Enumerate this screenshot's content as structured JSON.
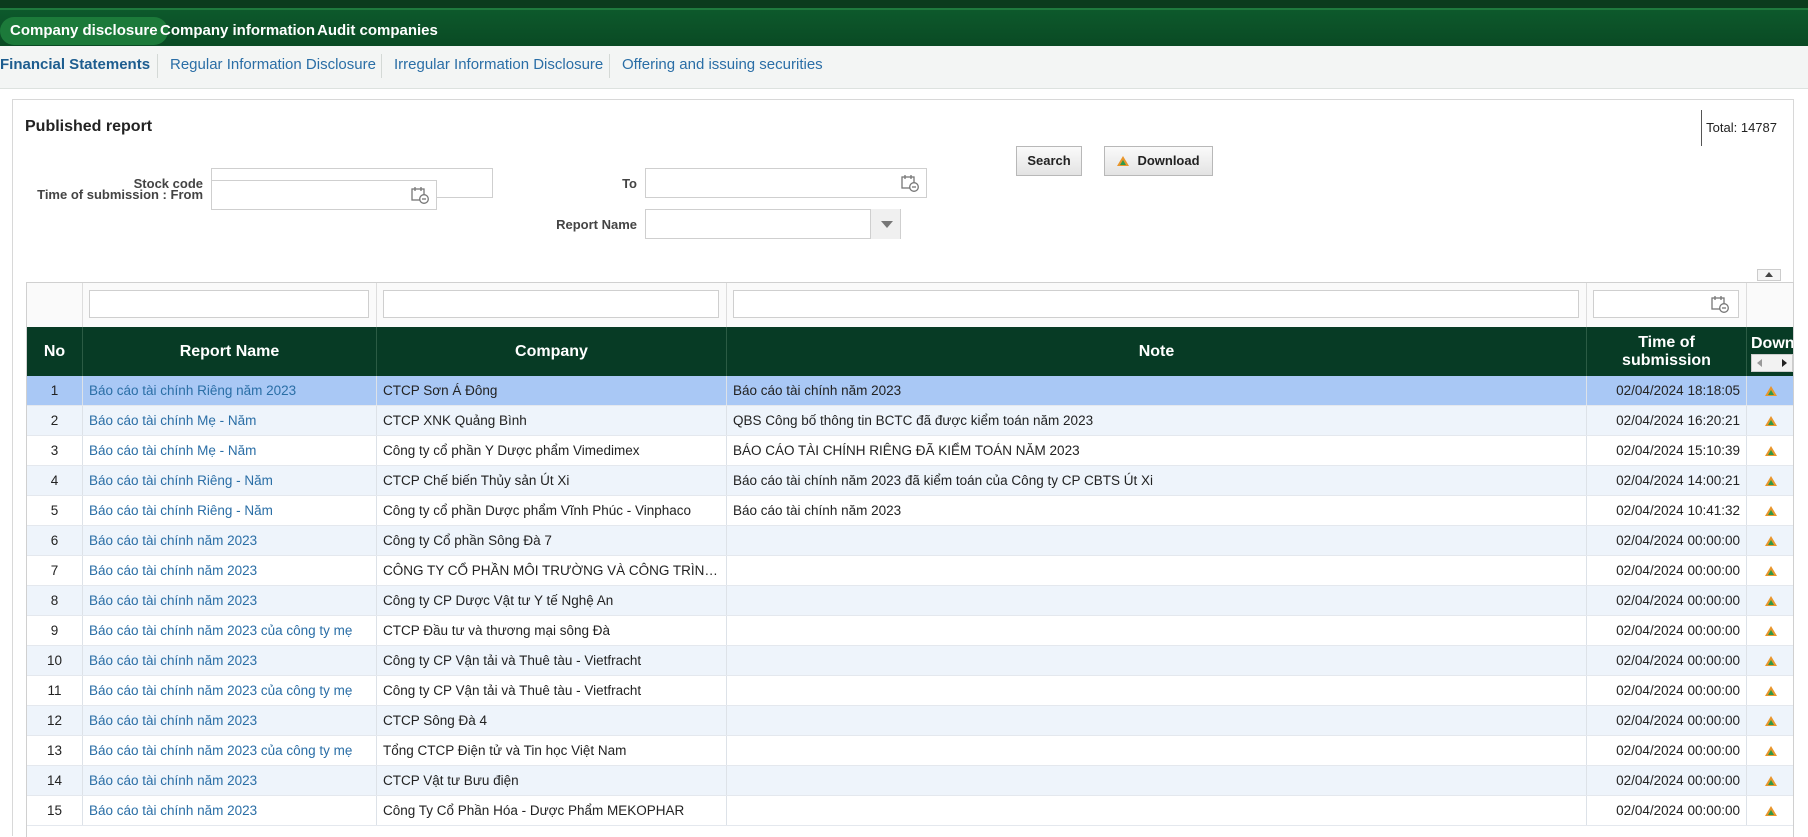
{
  "topnav": {
    "items": [
      "Company disclosure",
      "Company information",
      "Audit companies"
    ]
  },
  "subnav": {
    "items": [
      "Financial Statements",
      "Regular Information Disclosure",
      "Irregular Information Disclosure",
      "Offering and issuing securities"
    ]
  },
  "panel": {
    "title": "Published report",
    "total": "Total: 14787"
  },
  "form": {
    "stock_code_label": "Stock code",
    "to_label": "To",
    "from_label": "Time of submission : From",
    "report_name_label": "Report Name",
    "search_label": "Search",
    "download_label": "Download"
  },
  "table": {
    "columns": [
      "No",
      "Report Name",
      "Company",
      "Note",
      "Time of submission",
      "Down"
    ],
    "rows": [
      {
        "no": "1",
        "report": "Báo cáo tài chính Riêng năm 2023",
        "company": "CTCP Sơn Á Đông",
        "note": "Báo cáo tài chính năm 2023",
        "time": "02/04/2024 18:18:05"
      },
      {
        "no": "2",
        "report": "Báo cáo tài chính Mẹ - Năm",
        "company": "CTCP XNK Quảng Bình",
        "note": "QBS Công bố thông tin BCTC đã được kiểm toán năm 2023",
        "time": "02/04/2024 16:20:21"
      },
      {
        "no": "3",
        "report": "Báo cáo tài chính Mẹ - Năm",
        "company": "Công ty cổ phần Y Dược phẩm Vimedimex",
        "note": "BÁO CÁO TÀI CHÍNH RIÊNG ĐÃ KIỂM TOÁN NĂM 2023",
        "time": "02/04/2024 15:10:39"
      },
      {
        "no": "4",
        "report": "Báo cáo tài chính Riêng - Năm",
        "company": "CTCP Chế biến Thủy sản Út Xi",
        "note": "Báo cáo tài chính năm 2023 đã kiểm toán của Công ty CP CBTS Út Xi",
        "time": "02/04/2024 14:00:21"
      },
      {
        "no": "5",
        "report": "Báo cáo tài chính Riêng - Năm",
        "company": "Công ty cổ phần Dược phẩm Vĩnh Phúc - Vinphaco",
        "note": "Báo cáo tài chính năm 2023",
        "time": "02/04/2024 10:41:32"
      },
      {
        "no": "6",
        "report": "Báo cáo tài chính năm 2023",
        "company": "Công ty Cổ phần Sông Đà 7",
        "note": "",
        "time": "02/04/2024 00:00:00"
      },
      {
        "no": "7",
        "report": "Báo cáo tài chính năm 2023",
        "company": "CÔNG TY CỔ PHẦN MÔI TRƯỜNG VÀ CÔNG TRÌNH ĐÔ THỊ",
        "note": "",
        "time": "02/04/2024 00:00:00"
      },
      {
        "no": "8",
        "report": "Báo cáo tài chính năm 2023",
        "company": "Công ty CP Dược Vật tư Y tế Nghệ An",
        "note": "",
        "time": "02/04/2024 00:00:00"
      },
      {
        "no": "9",
        "report": "Báo cáo tài chính năm 2023 của công ty mẹ",
        "company": "CTCP Đầu tư và thương mại sông Đà",
        "note": "",
        "time": "02/04/2024 00:00:00"
      },
      {
        "no": "10",
        "report": "Báo cáo tài chính năm 2023",
        "company": "Công ty CP Vận tải và Thuê tàu - Vietfracht",
        "note": "",
        "time": "02/04/2024 00:00:00"
      },
      {
        "no": "11",
        "report": "Báo cáo tài chính năm 2023 của công ty mẹ",
        "company": "Công ty CP Vận tải và Thuê tàu - Vietfracht",
        "note": "",
        "time": "02/04/2024 00:00:00"
      },
      {
        "no": "12",
        "report": "Báo cáo tài chính năm 2023",
        "company": "CTCP Sông Đà 4",
        "note": "",
        "time": "02/04/2024 00:00:00"
      },
      {
        "no": "13",
        "report": "Báo cáo tài chính năm 2023 của công ty mẹ",
        "company": "Tổng CTCP Điện tử và Tin học Việt Nam",
        "note": "",
        "time": "02/04/2024 00:00:00"
      },
      {
        "no": "14",
        "report": "Báo cáo tài chính năm 2023",
        "company": "CTCP Vật tư Bưu điện",
        "note": "",
        "time": "02/04/2024 00:00:00"
      },
      {
        "no": "15",
        "report": "Báo cáo tài chính năm 2023",
        "company": "Công Ty Cổ Phần Hóa - Dược Phẩm MEKOPHAR",
        "note": "",
        "time": "02/04/2024 00:00:00"
      }
    ]
  }
}
